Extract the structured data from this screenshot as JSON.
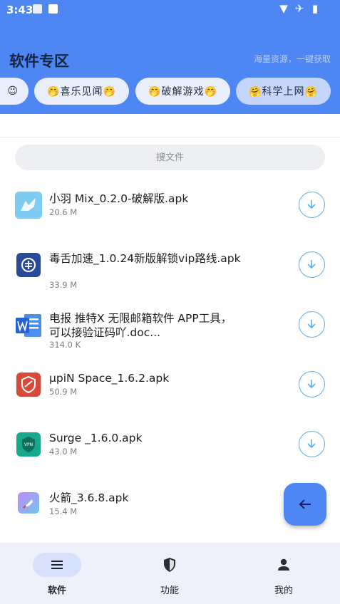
{
  "status_bar": {
    "time": "3:43",
    "icons": [
      "download-notification-icon",
      "app-notification-icon",
      "wifi-icon",
      "airplane-mode-icon",
      "battery-icon"
    ]
  },
  "header": {
    "title": "软件专区",
    "subtitle": "海量资源，一键获取"
  },
  "categories": [
    {
      "label": "😉",
      "icon": "wink-emoji"
    },
    {
      "label": "🤭喜乐见闻🤭",
      "icon": "smile-emoji"
    },
    {
      "label": "🤭破解游戏🤭",
      "icon": "smile-emoji"
    },
    {
      "label": "🤗科学上网🤗",
      "icon": "hug-emoji",
      "selected": true
    }
  ],
  "search": {
    "placeholder": "搜文件"
  },
  "files": [
    {
      "name": "小羽 Mix_0.2.0-破解版.apk",
      "size": "20.6 M",
      "icon": "bird-app-icon"
    },
    {
      "name": "毒舌加速_1.0.24新版解锁vip路线.apk",
      "size": "33.9 M",
      "icon": "accelerator-app-icon"
    },
    {
      "name": "电报 推特X 无限邮箱软件 APP工具，可以接验证码吖.doc...",
      "size": "314.0 K",
      "icon": "word-document-icon"
    },
    {
      "name": "μpiN Space_1.6.2.apk",
      "size": "50.9 M",
      "icon": "shield-app-icon"
    },
    {
      "name": "Surge _1.6.0.apk",
      "size": "43.0 M",
      "icon": "vpn-app-icon"
    },
    {
      "name": "火箭_3.6.8.apk",
      "size": "15.4 M",
      "icon": "rocket-app-icon"
    }
  ],
  "fab": {
    "icon": "arrow-left-icon"
  },
  "bottom_nav": [
    {
      "label": "软件",
      "icon": "menu-icon",
      "active": true
    },
    {
      "label": "功能",
      "icon": "shield-icon",
      "active": false
    },
    {
      "label": "我的",
      "icon": "person-icon",
      "active": false
    }
  ],
  "colors": {
    "header_bg": "#4e86f3",
    "title": "#162544",
    "chip_bg": "#e9eefb",
    "chip_selected_bg": "#c6d6fb",
    "download_accent": "#5ab0f0",
    "bottom_nav_bg": "#eef0fb"
  }
}
